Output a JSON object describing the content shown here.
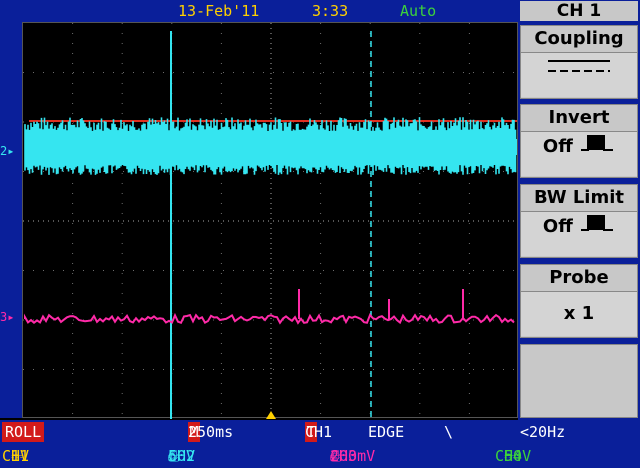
{
  "header": {
    "date": "13-Feb'11",
    "time": "3:33",
    "trigger_mode": "Auto",
    "usb_icon": "usb-icon",
    "trigger_pulse_icon": "trigger-pulse-icon"
  },
  "menu": {
    "title": "CH 1",
    "coupling": {
      "label": "Coupling",
      "value_icon": "dc-coupling-icon"
    },
    "invert": {
      "label": "Invert",
      "value": "Off"
    },
    "bw_limit": {
      "label": "BW Limit",
      "value": "Off"
    },
    "probe": {
      "label": "Probe",
      "value": "x 1"
    }
  },
  "status": {
    "mode": "ROLL",
    "timebase_marker": "M",
    "timebase": "250ms",
    "trigger_marker": "T",
    "trigger_source": "CH1",
    "trigger_type": "EDGE",
    "trigger_slope": "\\",
    "trigger_freq": "<20Hz"
  },
  "channels": {
    "ch1": {
      "name": "CH1",
      "scale": "1V",
      "color": "#ffd000"
    },
    "ch2": {
      "name": "CH2",
      "scale": "50V",
      "color": "#35e5f0"
    },
    "ch3": {
      "name": "CH3",
      "scale": "200mV",
      "color": "#ff2aa8"
    },
    "ch4": {
      "name": "CH4",
      "scale": "50V",
      "color": "#3cd23c"
    }
  },
  "markers": {
    "ch2": "2",
    "ch3": "3"
  }
}
